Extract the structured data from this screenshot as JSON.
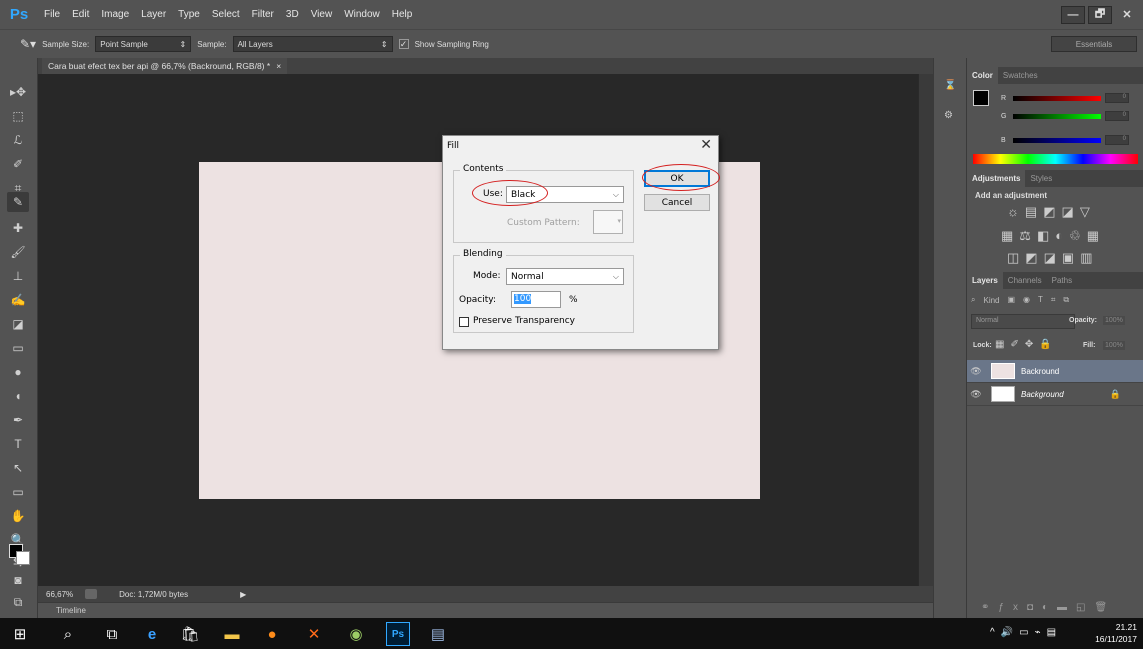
{
  "app": {
    "logo": "Ps"
  },
  "menu": [
    "File",
    "Edit",
    "Image",
    "Layer",
    "Type",
    "Select",
    "Filter",
    "3D",
    "View",
    "Window",
    "Help"
  ],
  "window_buttons": {
    "minimize": "—",
    "restore": "🗗",
    "close": "✕"
  },
  "options_bar": {
    "sample_size_label": "Sample Size:",
    "sample_size_value": "Point Sample",
    "sample_label": "Sample:",
    "sample_value": "All Layers",
    "show_sampling_ring_label": "Show Sampling Ring",
    "workspace": "Essentials"
  },
  "document": {
    "tab_title": "Cara buat efect tex ber api @ 66,7% (Backround, RGB/8) *",
    "tab_close": "×",
    "canvas_color": "#ede2e2"
  },
  "status_bar": {
    "zoom": "66,67%",
    "doc_info": "Doc: 1,72M/0 bytes"
  },
  "timeline": {
    "label": "Timeline"
  },
  "color_panel": {
    "tabs": [
      "Color",
      "Swatches"
    ],
    "r_label": "R",
    "g_label": "G",
    "b_label": "B",
    "r_value": "0",
    "g_value": "0",
    "b_value": "0"
  },
  "adjustments_panel": {
    "tabs": [
      "Adjustments",
      "Styles"
    ],
    "heading": "Add an adjustment"
  },
  "layers_panel": {
    "tabs": [
      "Layers",
      "Channels",
      "Paths"
    ],
    "filter_kind": "Kind",
    "blend_mode": "Normal",
    "opacity_label": "Opacity:",
    "opacity_value": "100%",
    "lock_label": "Lock:",
    "fill_label": "Fill:",
    "fill_value": "100%",
    "layers": [
      {
        "name": "Backround",
        "selected": true,
        "thumb_color": "#ede2e2"
      },
      {
        "name": "Background",
        "selected": false,
        "thumb_color": "#ffffff"
      }
    ]
  },
  "fill_dialog": {
    "title": "Fill",
    "close": "✕",
    "contents_group": "Contents",
    "use_label": "Use:",
    "use_value": "Black",
    "custom_pattern_label": "Custom Pattern:",
    "blending_group": "Blending",
    "mode_label": "Mode:",
    "mode_value": "Normal",
    "opacity_label": "Opacity:",
    "opacity_value": "100",
    "opacity_unit": "%",
    "preserve_transparency_label": "Preserve Transparency",
    "ok_label": "OK",
    "cancel_label": "Cancel"
  },
  "taskbar": {
    "time": "21.21",
    "date": "16/11/2017"
  }
}
